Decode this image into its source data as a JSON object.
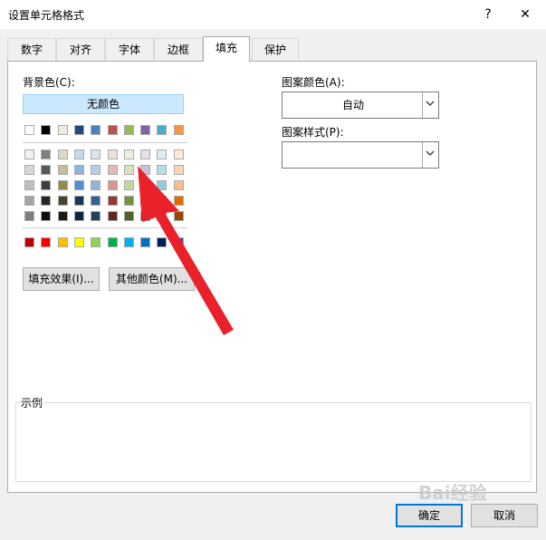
{
  "window": {
    "title": "设置单元格格式",
    "help_label": "?",
    "close_label": "✕"
  },
  "tabs": [
    {
      "label": "数字"
    },
    {
      "label": "对齐"
    },
    {
      "label": "字体"
    },
    {
      "label": "边框"
    },
    {
      "label": "填充",
      "active": true
    },
    {
      "label": "保护"
    }
  ],
  "background": {
    "label": "背景色(C):",
    "no_color_label": "无颜色",
    "theme_top_row": [
      "#ffffff",
      "#000000",
      "#eeece1",
      "#1f497d",
      "#4f81bd",
      "#c0504d",
      "#9bbb59",
      "#8064a2",
      "#4bacc6",
      "#f79646"
    ],
    "theme_shades": [
      [
        "#f2f2f2",
        "#7f7f7f",
        "#ddd9c3",
        "#c6d9f0",
        "#dbe5f1",
        "#f2dcdb",
        "#ebf1dd",
        "#e5e0ec",
        "#dbeef3",
        "#fdeada"
      ],
      [
        "#d8d8d8",
        "#595959",
        "#c4bd97",
        "#8db3e2",
        "#b8cce4",
        "#e5b9b7",
        "#d7e3bc",
        "#ccc1d9",
        "#b7dde8",
        "#fbd5b5"
      ],
      [
        "#bfbfbf",
        "#3f3f3f",
        "#938953",
        "#548dd4",
        "#95b3d7",
        "#d99694",
        "#c3d69b",
        "#b2a2c7",
        "#92cddc",
        "#fac08f"
      ],
      [
        "#a5a5a5",
        "#262626",
        "#494429",
        "#17365d",
        "#366092",
        "#953734",
        "#76923c",
        "#5f497a",
        "#31859b",
        "#e36c09"
      ],
      [
        "#7f7f7f",
        "#0c0c0c",
        "#1d1b10",
        "#0f243e",
        "#244061",
        "#632423",
        "#4f6128",
        "#3f3151",
        "#205867",
        "#974806"
      ]
    ],
    "standard_colors": [
      "#c00000",
      "#ff0000",
      "#ffc000",
      "#ffff00",
      "#92d050",
      "#00b050",
      "#00b0f0",
      "#0070c0",
      "#002060",
      "#7030a0"
    ],
    "fill_effects_label": "填充效果(I)...",
    "more_colors_label": "其他颜色(M)..."
  },
  "pattern": {
    "color_label": "图案颜色(A):",
    "color_value": "自动",
    "style_label": "图案样式(P):",
    "style_value": ""
  },
  "sample": {
    "label": "示例"
  },
  "footer": {
    "ok_label": "确定",
    "cancel_label": "取消"
  },
  "watermark": {
    "text": "Bai经验"
  },
  "accent_arrow_color": "#e8212b"
}
